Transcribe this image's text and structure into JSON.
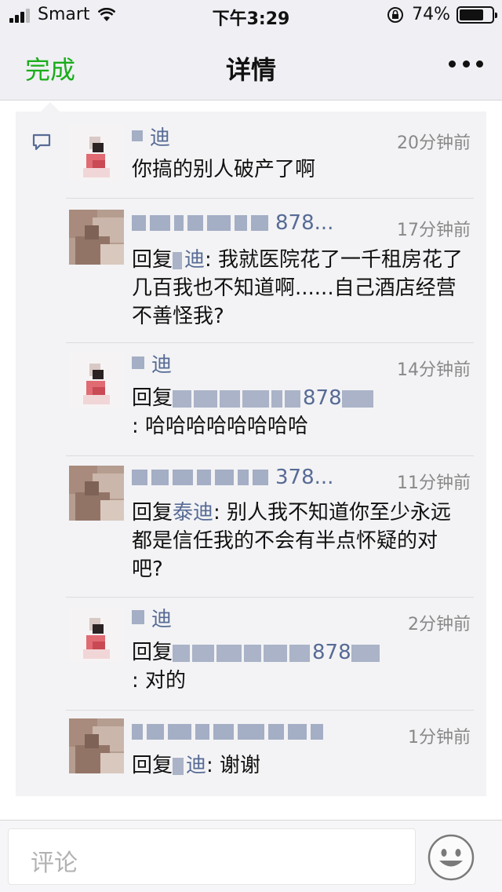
{
  "status_bar": {
    "carrier": "Smart",
    "time": "下午3:29",
    "battery": "74%",
    "battery_level": 0.74
  },
  "nav": {
    "done_label": "完成",
    "title": "详情",
    "more_icon": "more-icon"
  },
  "comments": [
    {
      "name": "迪",
      "time": "20分钟前",
      "text": "你搞的别人破产了啊"
    },
    {
      "name": "878...",
      "time": "17分钟前",
      "reply_prefix": "回复",
      "reply_to": "迪",
      "text": ": 我就医院花了一千租房花了几百我也不知道啊......自己酒店经营不善怪我?"
    },
    {
      "name": "迪",
      "time": "14分钟前",
      "reply_prefix": "回复",
      "reply_to": "878",
      "text": ": 哈哈哈哈哈哈哈哈"
    },
    {
      "name": "378...",
      "time": "11分钟前",
      "reply_prefix": "回复",
      "reply_to": "泰迪",
      "text": ": 别人我不知道你至少永远都是信任我的不会有半点怀疑的对吧?"
    },
    {
      "name": "迪",
      "time": "2分钟前",
      "reply_prefix": "回复",
      "reply_to": "878",
      "text": ": 对的"
    },
    {
      "name": "",
      "time": "1分钟前",
      "reply_prefix": "回复",
      "reply_to": "迪",
      "text": ": 谢谢"
    }
  ],
  "input": {
    "placeholder": "评论"
  },
  "colors": {
    "accent_green": "#1aad19",
    "link_blue": "#576b95"
  }
}
